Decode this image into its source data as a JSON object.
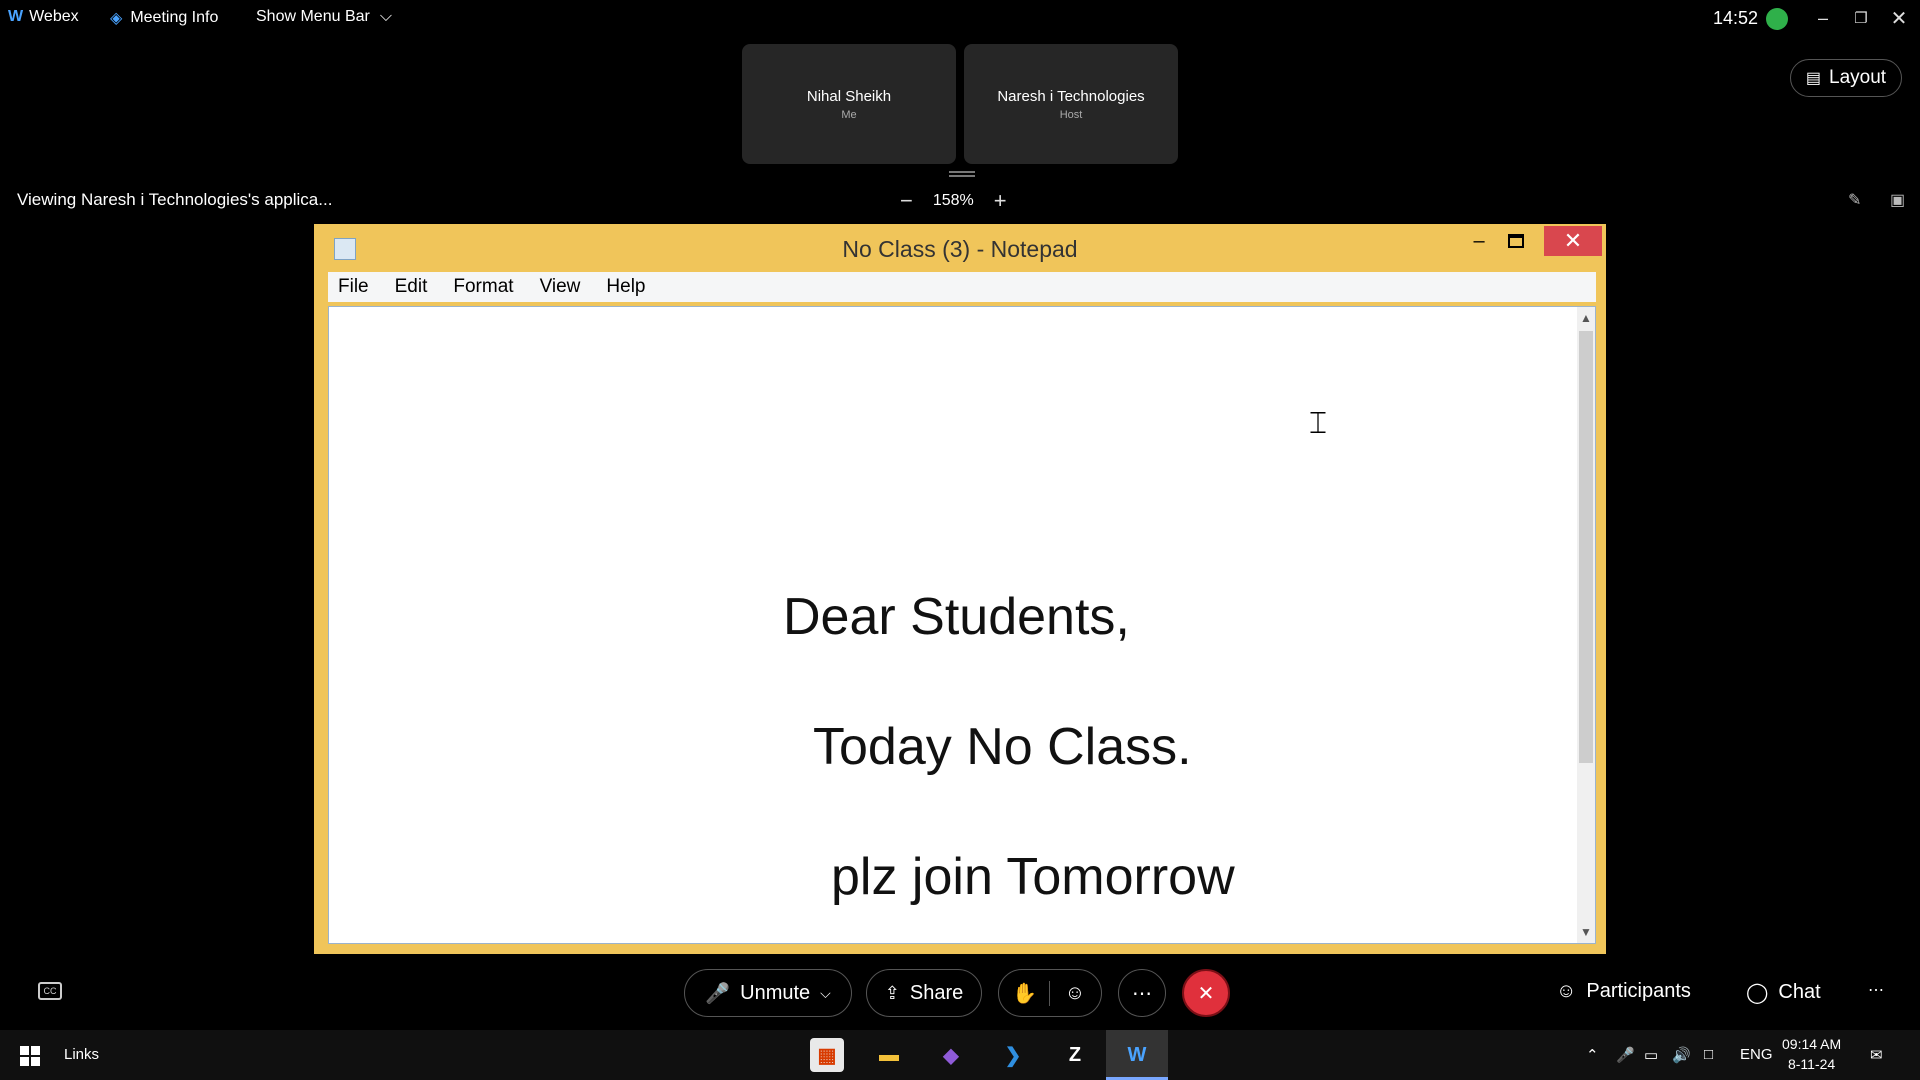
{
  "top_bar": {
    "app_name": "Webex",
    "meeting_info": "Meeting Info",
    "show_menu_bar": "Show Menu Bar",
    "time": "14:52"
  },
  "participants": [
    {
      "name": "Nihal Sheikh",
      "role": "Me"
    },
    {
      "name": "Naresh i Technologies",
      "role": "Host"
    }
  ],
  "layout_label": "Layout",
  "share_bar": {
    "viewing_text": "Viewing Naresh i Technologies's applica...",
    "zoom_level": "158%"
  },
  "notepad": {
    "title": "No Class (3) - Notepad",
    "menu": [
      "File",
      "Edit",
      "Format",
      "View",
      "Help"
    ],
    "lines": [
      "Dear Students,",
      "Today No Class.",
      "plz join Tomorrow"
    ]
  },
  "controls": {
    "unmute": "Unmute",
    "share": "Share",
    "participants": "Participants",
    "chat": "Chat"
  },
  "taskbar": {
    "links": "Links",
    "language": "ENG",
    "clock_time": "09:14 AM",
    "clock_date": "8-11-24"
  },
  "colors": {
    "end_call": "#e0303c",
    "notepad_frame": "#f0c55a",
    "notepad_close": "#d9474e",
    "network_indicator": "#2fb04a"
  }
}
